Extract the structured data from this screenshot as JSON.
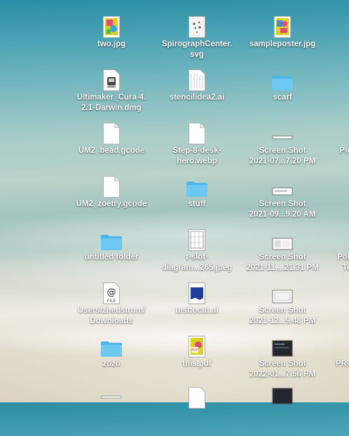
{
  "icons": [
    {
      "label": "two.jpg",
      "icon": "jpg-image-icon"
    },
    {
      "label": "SpirographCenter.\nsvg",
      "icon": "svg-file-icon"
    },
    {
      "label": "sampleposter.jpg",
      "icon": "jpg-image-icon"
    },
    {
      "label": "Ultimaker_Cura-4.\n2.1-Darwin.dmg",
      "icon": "disk-image-icon"
    },
    {
      "label": "stencilidea2.ai",
      "icon": "ai-file-icon"
    },
    {
      "label": "scarf",
      "icon": "folder-icon"
    },
    {
      "label": "UM2_bead.gcode",
      "icon": "document-icon"
    },
    {
      "label": "Step-8-desk-\nhero.webp",
      "icon": "document-icon"
    },
    {
      "label": "Screen Shot\n2021-07...7.20 PM",
      "icon": "screenshot-icon"
    },
    {
      "label": "UM2_zoetry.gcode",
      "icon": "document-icon"
    },
    {
      "label": "stuff",
      "icon": "folder-icon"
    },
    {
      "label": "Screen Shot\n2021-09...9.20 AM",
      "icon": "screenshot-icon"
    },
    {
      "label": "untitled folder",
      "icon": "folder-icon"
    },
    {
      "label": "t-slot-\ndiagram...265.jpeg",
      "icon": "jpeg-image-icon"
    },
    {
      "label": "Screen Shot\n2021-11....21.31 PM",
      "icon": "screenshot-icon"
    },
    {
      "label": "Users/zhedstrom/\nDownloads",
      "icon": "at-file-icon"
    },
    {
      "label": "testtocut.ai",
      "icon": "ai-file-icon"
    },
    {
      "label": "Screen Shot\n2021-12...9.48 PM",
      "icon": "screenshot-icon"
    },
    {
      "label": "zozo",
      "icon": "folder-icon"
    },
    {
      "label": "this.pdf",
      "icon": "pdf-file-icon"
    },
    {
      "label": "Screen Shot\n2022-01...7.56 PM",
      "icon": "screenshot-icon"
    },
    {
      "label": "Pict",
      "icon": "screenshot-icon"
    },
    {
      "label": "Poke\nTe",
      "icon": "screenshot-icon"
    },
    {
      "label": "PROT",
      "icon": "screenshot-icon"
    }
  ]
}
